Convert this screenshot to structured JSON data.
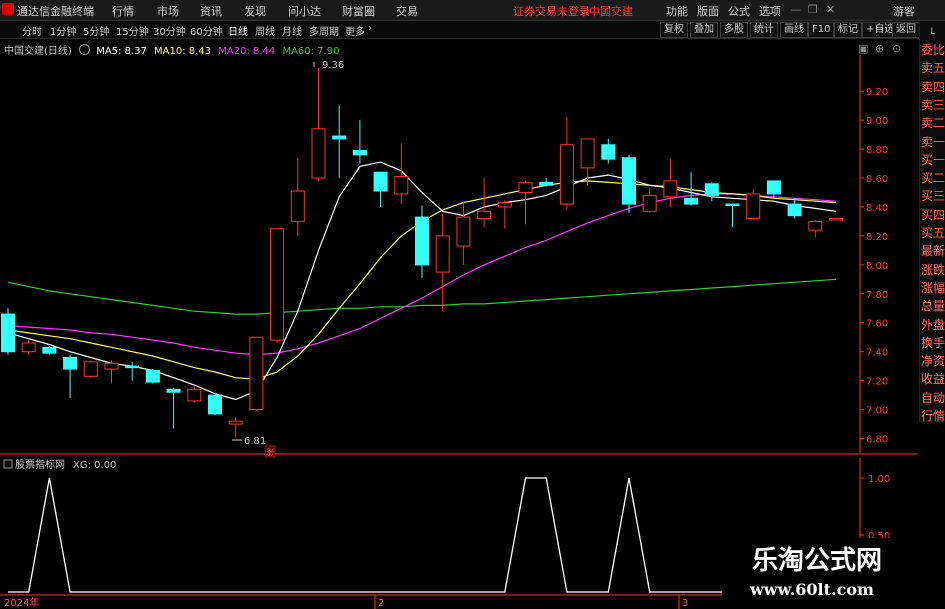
{
  "menubar": {
    "app_name": "通达信金融终端",
    "items": [
      "行情",
      "市场",
      "资讯",
      "发现",
      "问小达",
      "财富圈",
      "交易"
    ],
    "notice": "证券交易未登录",
    "stock_title": "中国交建",
    "right_items": [
      "功能",
      "版面",
      "公式",
      "选项"
    ],
    "guest": "游客"
  },
  "toolbar": {
    "periods": [
      "分时",
      "1分钟",
      "5分钟",
      "15分钟",
      "30分钟",
      "60分钟",
      "日线",
      "周线",
      "月线",
      "多周期",
      "更多"
    ],
    "active_period": "日线",
    "right_buttons": [
      "复权",
      "叠加",
      "多股",
      "统计",
      "画线",
      "F10",
      "标记",
      "+自选",
      "返回"
    ]
  },
  "chart_header": {
    "stock": "中国交建(日线)",
    "ma5": "MA5: 8.37",
    "ma10": "MA10: 8.43",
    "ma20": "MA20: 8.44",
    "ma60": "MA60: 7.90"
  },
  "colors": {
    "up": "#ff3333",
    "down": "#33ffff",
    "ma5": "#ffffff",
    "ma10": "#ffff66",
    "ma20": "#ff33ff",
    "ma60": "#33cc33",
    "axis": "#ff3333",
    "indicator": "#ffffff"
  },
  "price_axis": {
    "ticks": [
      "9.20",
      "9.00",
      "8.80",
      "8.60",
      "8.40",
      "8.20",
      "8.00",
      "7.80",
      "7.60",
      "7.40",
      "7.20",
      "7.00",
      "6.80"
    ]
  },
  "annotations": {
    "high": "9.36",
    "low": "6.81",
    "badge": "涨"
  },
  "right_sidebar": [
    "委比",
    "卖五",
    "卖四",
    "卖三",
    "卖二",
    "卖一",
    "买一",
    "买二",
    "买三",
    "买四",
    "买五",
    "最新",
    "涨跌",
    "涨幅",
    "总量",
    "外盘",
    "换手",
    "净资",
    "收益",
    "自动",
    "行情"
  ],
  "indicator_panel": {
    "title": "股票指标网",
    "value_label": "XG: 0.00",
    "ticks": [
      "1.00",
      "0.50"
    ]
  },
  "date_axis": {
    "labels": [
      "2024年",
      "2",
      "3"
    ]
  },
  "watermark": {
    "line1": "乐淘公式网",
    "line2": "www.60lt.com"
  },
  "chart_data": {
    "type": "candlestick",
    "ylim": [
      6.7,
      9.45
    ],
    "candles": [
      {
        "o": 7.66,
        "h": 7.7,
        "l": 7.38,
        "c": 7.4
      },
      {
        "o": 7.4,
        "h": 7.48,
        "l": 7.38,
        "c": 7.46
      },
      {
        "o": 7.43,
        "h": 7.44,
        "l": 7.38,
        "c": 7.39
      },
      {
        "o": 7.36,
        "h": 7.38,
        "l": 7.08,
        "c": 7.28
      },
      {
        "o": 7.23,
        "h": 7.34,
        "l": 7.22,
        "c": 7.33
      },
      {
        "o": 7.28,
        "h": 7.34,
        "l": 7.18,
        "c": 7.32
      },
      {
        "o": 7.3,
        "h": 7.33,
        "l": 7.2,
        "c": 7.29
      },
      {
        "o": 7.27,
        "h": 7.28,
        "l": 7.18,
        "c": 7.19
      },
      {
        "o": 7.14,
        "h": 7.15,
        "l": 6.87,
        "c": 7.12
      },
      {
        "o": 7.06,
        "h": 7.16,
        "l": 7.05,
        "c": 7.14
      },
      {
        "o": 7.1,
        "h": 7.1,
        "l": 6.96,
        "c": 6.97
      },
      {
        "o": 6.9,
        "h": 6.95,
        "l": 6.81,
        "c": 6.92
      },
      {
        "o": 7.0,
        "h": 7.5,
        "l": 6.99,
        "c": 7.5
      },
      {
        "o": 7.48,
        "h": 8.25,
        "l": 7.46,
        "c": 8.25
      },
      {
        "o": 8.3,
        "h": 8.74,
        "l": 8.2,
        "c": 8.51
      },
      {
        "o": 8.6,
        "h": 9.36,
        "l": 8.58,
        "c": 8.94
      },
      {
        "o": 8.89,
        "h": 9.1,
        "l": 8.6,
        "c": 8.87
      },
      {
        "o": 8.79,
        "h": 9.0,
        "l": 8.7,
        "c": 8.76
      },
      {
        "o": 8.64,
        "h": 8.64,
        "l": 8.4,
        "c": 8.51
      },
      {
        "o": 8.49,
        "h": 8.84,
        "l": 8.42,
        "c": 8.61
      },
      {
        "o": 8.33,
        "h": 8.41,
        "l": 7.91,
        "c": 8.0
      },
      {
        "o": 7.95,
        "h": 8.35,
        "l": 7.68,
        "c": 8.2
      },
      {
        "o": 8.13,
        "h": 8.44,
        "l": 8.0,
        "c": 8.33
      },
      {
        "o": 8.32,
        "h": 8.6,
        "l": 8.26,
        "c": 8.37
      },
      {
        "o": 8.4,
        "h": 8.45,
        "l": 8.25,
        "c": 8.43
      },
      {
        "o": 8.5,
        "h": 8.58,
        "l": 8.28,
        "c": 8.57
      },
      {
        "o": 8.57,
        "h": 8.6,
        "l": 8.54,
        "c": 8.55
      },
      {
        "o": 8.42,
        "h": 9.02,
        "l": 8.38,
        "c": 8.83
      },
      {
        "o": 8.67,
        "h": 8.87,
        "l": 8.55,
        "c": 8.87
      },
      {
        "o": 8.83,
        "h": 8.87,
        "l": 8.7,
        "c": 8.73
      },
      {
        "o": 8.74,
        "h": 8.76,
        "l": 8.36,
        "c": 8.42
      },
      {
        "o": 8.37,
        "h": 8.53,
        "l": 8.36,
        "c": 8.48
      },
      {
        "o": 8.47,
        "h": 8.73,
        "l": 8.4,
        "c": 8.58
      },
      {
        "o": 8.46,
        "h": 8.64,
        "l": 8.41,
        "c": 8.42
      },
      {
        "o": 8.56,
        "h": 8.57,
        "l": 8.44,
        "c": 8.48
      },
      {
        "o": 8.42,
        "h": 8.42,
        "l": 8.26,
        "c": 8.41
      },
      {
        "o": 8.32,
        "h": 8.52,
        "l": 8.31,
        "c": 8.49
      },
      {
        "o": 8.58,
        "h": 8.58,
        "l": 8.46,
        "c": 8.49
      },
      {
        "o": 8.42,
        "h": 8.46,
        "l": 8.32,
        "c": 8.34
      },
      {
        "o": 8.24,
        "h": 8.31,
        "l": 8.19,
        "c": 8.3
      },
      {
        "o": 8.31,
        "h": 8.32,
        "l": 8.31,
        "c": 8.32
      }
    ],
    "ma5": [
      7.53,
      7.49,
      7.45,
      7.4,
      7.36,
      7.32,
      7.3,
      7.27,
      7.22,
      7.17,
      7.11,
      7.07,
      7.13,
      7.36,
      7.68,
      8.1,
      8.47,
      8.68,
      8.71,
      8.65,
      8.5,
      8.37,
      8.34,
      8.4,
      8.43,
      8.45,
      8.48,
      8.54,
      8.6,
      8.62,
      8.59,
      8.55,
      8.53,
      8.5,
      8.47,
      8.46,
      8.45,
      8.44,
      8.41,
      8.39,
      8.37
    ],
    "ma10": [
      7.55,
      7.53,
      7.51,
      7.49,
      7.46,
      7.43,
      7.4,
      7.37,
      7.33,
      7.29,
      7.26,
      7.22,
      7.21,
      7.26,
      7.37,
      7.52,
      7.7,
      7.87,
      8.05,
      8.2,
      8.3,
      8.38,
      8.43,
      8.46,
      8.49,
      8.52,
      8.55,
      8.57,
      8.58,
      8.57,
      8.56,
      8.55,
      8.54,
      8.52,
      8.5,
      8.49,
      8.48,
      8.46,
      8.45,
      8.44,
      8.43
    ],
    "ma20": [
      7.58,
      7.57,
      7.56,
      7.55,
      7.53,
      7.52,
      7.5,
      7.48,
      7.46,
      7.43,
      7.41,
      7.39,
      7.38,
      7.39,
      7.42,
      7.46,
      7.51,
      7.56,
      7.63,
      7.7,
      7.77,
      7.85,
      7.93,
      8.0,
      8.06,
      8.12,
      8.17,
      8.23,
      8.29,
      8.34,
      8.39,
      8.43,
      8.46,
      8.48,
      8.49,
      8.49,
      8.48,
      8.47,
      8.46,
      8.45,
      8.44
    ],
    "ma60": [
      7.88,
      7.85,
      7.82,
      7.8,
      7.78,
      7.76,
      7.74,
      7.72,
      7.7,
      7.68,
      7.67,
      7.66,
      7.66,
      7.67,
      7.68,
      7.69,
      7.7,
      7.7,
      7.71,
      7.71,
      7.72,
      7.72,
      7.73,
      7.73,
      7.74,
      7.75,
      7.76,
      7.77,
      7.78,
      7.79,
      7.8,
      7.81,
      7.82,
      7.83,
      7.84,
      7.85,
      7.86,
      7.87,
      7.88,
      7.89,
      7.9
    ],
    "xg": [
      0,
      0,
      1,
      0,
      0,
      0,
      0,
      0,
      0,
      0,
      0,
      0,
      0,
      0,
      0,
      0,
      0,
      0,
      0,
      0,
      0,
      0,
      0,
      0,
      0,
      1,
      1,
      0,
      0,
      0,
      1,
      0,
      0,
      0,
      0,
      0,
      0,
      0,
      0,
      0,
      0
    ]
  }
}
